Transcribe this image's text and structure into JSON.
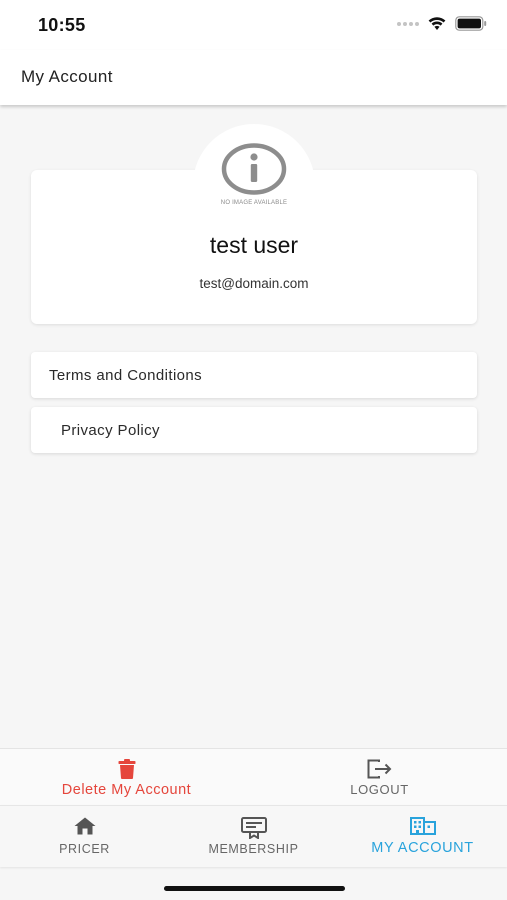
{
  "status_bar": {
    "time": "10:55",
    "icons": [
      "cellular-signal-icon",
      "wifi-icon",
      "battery-icon"
    ]
  },
  "header": {
    "title": "My Account"
  },
  "profile": {
    "avatar_icon": "info-icon",
    "avatar_caption": "NO IMAGE AVAILABLE",
    "name": "test user",
    "email": "test@domain.com"
  },
  "menu": {
    "items": [
      {
        "label": "Terms and Conditions"
      },
      {
        "label": "Privacy Policy"
      }
    ]
  },
  "actions": {
    "delete": {
      "label": "Delete My Account",
      "icon": "trash-icon",
      "color": "#e5463c"
    },
    "logout": {
      "label": "LOGOUT",
      "icon": "logout-icon"
    }
  },
  "tabs": [
    {
      "label": "PRICER",
      "icon": "home-icon",
      "active": false
    },
    {
      "label": "MEMBERSHIP",
      "icon": "card-icon",
      "active": false
    },
    {
      "label": "MY ACCOUNT",
      "icon": "building-icon",
      "active": true
    }
  ],
  "colors": {
    "accent": "#29a3dc",
    "danger": "#e5463c",
    "background": "#f6f6f6"
  }
}
